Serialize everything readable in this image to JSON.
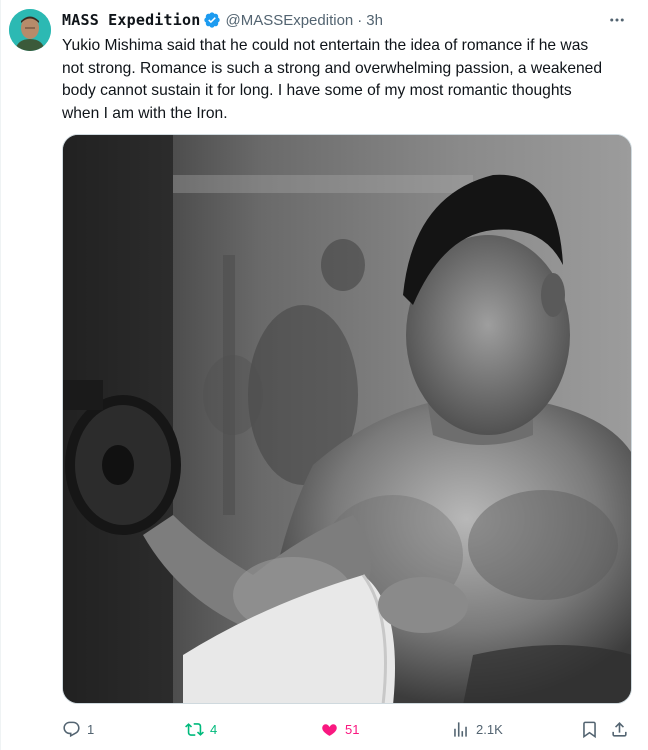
{
  "author": {
    "display_name": "MASS Expedition",
    "handle": "@MASSExpedition",
    "separator": "·",
    "time": "3h",
    "verified": true,
    "verified_color": "#1d9bf0"
  },
  "tweet": {
    "text": "Yukio Mishima said that he could not entertain the idea of romance if he was\nnot strong. Romance is such a strong and overwhelming passion, a weakened\nbody cannot sustain it for long. I have some of my most romantic thoughts\nwhen I am with the Iron.",
    "media": {
      "type": "photo",
      "subject": "black-and-white photo of a shirtless man curling a dumbbell in a gym"
    }
  },
  "actions": {
    "replies": "1",
    "retweets": "4",
    "likes": "51",
    "views": "2.1K"
  },
  "colors": {
    "text": "#0f1419",
    "secondary": "#536471",
    "retweet_active": "#00ba7c",
    "like_active": "#f91880",
    "avatar_bg": "#2cb9b3"
  },
  "icons": {
    "more": "more-horizontal-icon",
    "reply": "reply-icon",
    "retweet": "retweet-icon",
    "like": "heart-filled-icon",
    "views": "views-chart-icon",
    "bookmark": "bookmark-icon",
    "share": "share-icon",
    "verified": "verified-badge-icon"
  }
}
